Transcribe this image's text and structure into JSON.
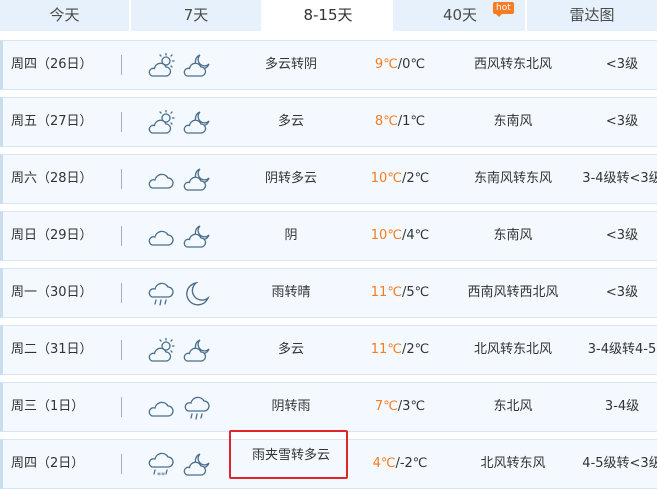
{
  "tabs": [
    {
      "label": "今天",
      "width": 131
    },
    {
      "label": "7天",
      "width": 132
    },
    {
      "label": "8-15天",
      "width": 132,
      "active": true
    },
    {
      "label": "40天",
      "width": 132,
      "badge": "hot"
    },
    {
      "label": "雷达图",
      "width": 130
    }
  ],
  "rows": [
    {
      "date": "周四（26日）",
      "icons": [
        "partly-cloudy-day-icon",
        "partly-cloudy-night-icon"
      ],
      "desc": "多云转阴",
      "high": "9℃",
      "low": "/0℃",
      "wind": "西风转东北风",
      "level": "<3级"
    },
    {
      "date": "周五（27日）",
      "icons": [
        "partly-cloudy-day-icon",
        "partly-cloudy-night-icon"
      ],
      "desc": "多云",
      "high": "8℃",
      "low": "/1℃",
      "wind": "东南风",
      "level": "<3级"
    },
    {
      "date": "周六（28日）",
      "icons": [
        "cloud-icon",
        "partly-cloudy-night-icon"
      ],
      "desc": "阴转多云",
      "high": "10℃",
      "low": "/2℃",
      "wind": "东南风转东风",
      "level": "3-4级转<3级"
    },
    {
      "date": "周日（29日）",
      "icons": [
        "cloud-icon",
        "partly-cloudy-night-icon"
      ],
      "desc": "阴",
      "high": "10℃",
      "low": "/4℃",
      "wind": "东南风",
      "level": "<3级"
    },
    {
      "date": "周一（30日）",
      "icons": [
        "rain-icon",
        "moon-icon"
      ],
      "desc": "雨转晴",
      "high": "11℃",
      "low": "/5℃",
      "wind": "西南风转西北风",
      "level": "<3级"
    },
    {
      "date": "周二（31日）",
      "icons": [
        "partly-cloudy-day-icon",
        "partly-cloudy-night-icon"
      ],
      "desc": "多云",
      "high": "11℃",
      "low": "/2℃",
      "wind": "北风转东北风",
      "level": "3-4级转4-5"
    },
    {
      "date": "周三（1日）",
      "icons": [
        "cloud-icon",
        "rain-icon"
      ],
      "desc": "阴转雨",
      "high": "7℃",
      "low": "/3℃",
      "wind": "东北风",
      "level": "3-4级"
    },
    {
      "date": "周四（2日）",
      "icons": [
        "sleet-icon",
        "partly-cloudy-night-icon"
      ],
      "desc": "雨夹雪转多云",
      "high": "4℃",
      "low": "/-2℃",
      "wind": "北风转东风",
      "level": "4-5级转<3级",
      "highlighted": true
    }
  ],
  "colors": {
    "tab_bg": "#e6f1fb",
    "row_bg": "#f3f9fe",
    "high_temp": "#f57c20",
    "highlight": "#e0262b",
    "icon_stroke": "#4c6e8c"
  }
}
